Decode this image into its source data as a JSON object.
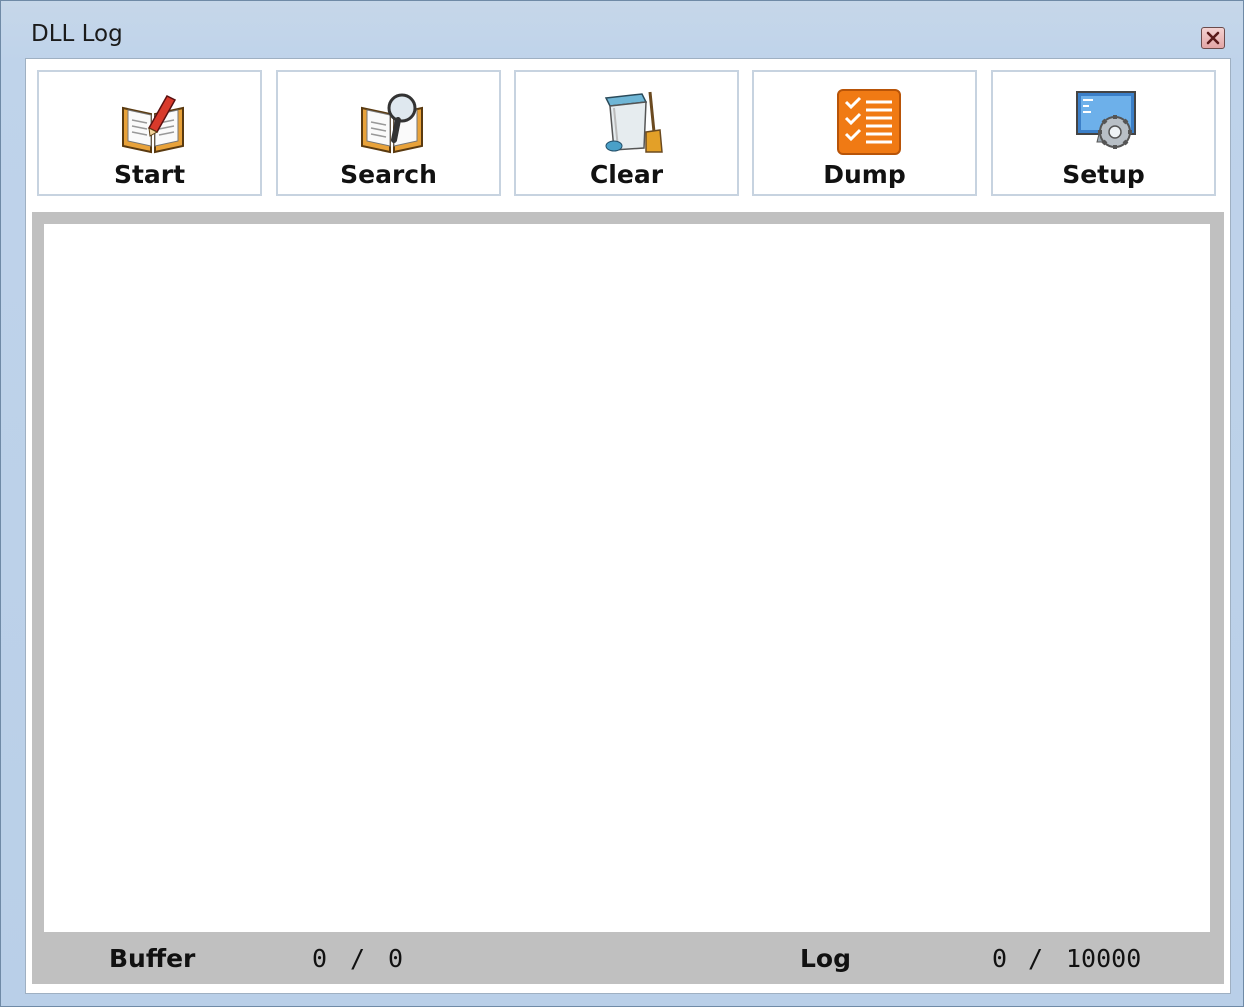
{
  "window": {
    "title": "DLL Log"
  },
  "toolbar": {
    "buttons": [
      {
        "label": "Start",
        "icon": "book-pencil-icon"
      },
      {
        "label": "Search",
        "icon": "book-magnifier-icon"
      },
      {
        "label": "Clear",
        "icon": "trash-broom-icon"
      },
      {
        "label": "Dump",
        "icon": "checklist-icon"
      },
      {
        "label": "Setup",
        "icon": "monitor-gear-icon"
      }
    ]
  },
  "log": {
    "content": ""
  },
  "status": {
    "buffer_label": "Buffer",
    "buffer_value": "0",
    "buffer_separator": "/",
    "buffer_total": "0",
    "log_label": "Log",
    "log_value": "0",
    "log_separator": "/",
    "log_total": "10000"
  },
  "colors": {
    "dump_icon": "#f07a14",
    "status_bar": "#c0c0c0"
  }
}
